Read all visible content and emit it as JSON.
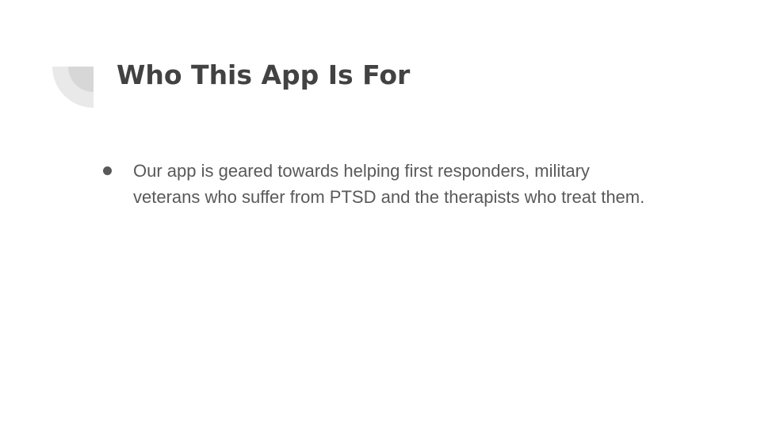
{
  "slide": {
    "title": "Who This App Is For",
    "bullets": [
      "Our app is geared towards helping first responders, military veterans who suffer from PTSD and the therapists who treat them."
    ]
  },
  "colors": {
    "title": "#424242",
    "body_text": "#595959",
    "decoration_outer": "#e9e9e9",
    "decoration_inner": "#d7d7d7",
    "background": "#ffffff"
  }
}
